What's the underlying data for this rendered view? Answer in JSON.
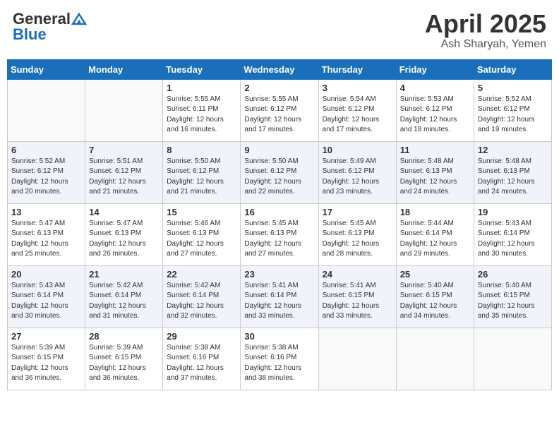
{
  "header": {
    "logo_general": "General",
    "logo_blue": "Blue",
    "title": "April 2025",
    "subtitle": "Ash Sharyah, Yemen"
  },
  "weekdays": [
    "Sunday",
    "Monday",
    "Tuesday",
    "Wednesday",
    "Thursday",
    "Friday",
    "Saturday"
  ],
  "weeks": [
    [
      {
        "day": "",
        "sunrise": "",
        "sunset": "",
        "daylight": ""
      },
      {
        "day": "",
        "sunrise": "",
        "sunset": "",
        "daylight": ""
      },
      {
        "day": "1",
        "sunrise": "Sunrise: 5:55 AM",
        "sunset": "Sunset: 6:11 PM",
        "daylight": "Daylight: 12 hours and 16 minutes."
      },
      {
        "day": "2",
        "sunrise": "Sunrise: 5:55 AM",
        "sunset": "Sunset: 6:12 PM",
        "daylight": "Daylight: 12 hours and 17 minutes."
      },
      {
        "day": "3",
        "sunrise": "Sunrise: 5:54 AM",
        "sunset": "Sunset: 6:12 PM",
        "daylight": "Daylight: 12 hours and 17 minutes."
      },
      {
        "day": "4",
        "sunrise": "Sunrise: 5:53 AM",
        "sunset": "Sunset: 6:12 PM",
        "daylight": "Daylight: 12 hours and 18 minutes."
      },
      {
        "day": "5",
        "sunrise": "Sunrise: 5:52 AM",
        "sunset": "Sunset: 6:12 PM",
        "daylight": "Daylight: 12 hours and 19 minutes."
      }
    ],
    [
      {
        "day": "6",
        "sunrise": "Sunrise: 5:52 AM",
        "sunset": "Sunset: 6:12 PM",
        "daylight": "Daylight: 12 hours and 20 minutes."
      },
      {
        "day": "7",
        "sunrise": "Sunrise: 5:51 AM",
        "sunset": "Sunset: 6:12 PM",
        "daylight": "Daylight: 12 hours and 21 minutes."
      },
      {
        "day": "8",
        "sunrise": "Sunrise: 5:50 AM",
        "sunset": "Sunset: 6:12 PM",
        "daylight": "Daylight: 12 hours and 21 minutes."
      },
      {
        "day": "9",
        "sunrise": "Sunrise: 5:50 AM",
        "sunset": "Sunset: 6:12 PM",
        "daylight": "Daylight: 12 hours and 22 minutes."
      },
      {
        "day": "10",
        "sunrise": "Sunrise: 5:49 AM",
        "sunset": "Sunset: 6:12 PM",
        "daylight": "Daylight: 12 hours and 23 minutes."
      },
      {
        "day": "11",
        "sunrise": "Sunrise: 5:48 AM",
        "sunset": "Sunset: 6:13 PM",
        "daylight": "Daylight: 12 hours and 24 minutes."
      },
      {
        "day": "12",
        "sunrise": "Sunrise: 5:48 AM",
        "sunset": "Sunset: 6:13 PM",
        "daylight": "Daylight: 12 hours and 24 minutes."
      }
    ],
    [
      {
        "day": "13",
        "sunrise": "Sunrise: 5:47 AM",
        "sunset": "Sunset: 6:13 PM",
        "daylight": "Daylight: 12 hours and 25 minutes."
      },
      {
        "day": "14",
        "sunrise": "Sunrise: 5:47 AM",
        "sunset": "Sunset: 6:13 PM",
        "daylight": "Daylight: 12 hours and 26 minutes."
      },
      {
        "day": "15",
        "sunrise": "Sunrise: 5:46 AM",
        "sunset": "Sunset: 6:13 PM",
        "daylight": "Daylight: 12 hours and 27 minutes."
      },
      {
        "day": "16",
        "sunrise": "Sunrise: 5:45 AM",
        "sunset": "Sunset: 6:13 PM",
        "daylight": "Daylight: 12 hours and 27 minutes."
      },
      {
        "day": "17",
        "sunrise": "Sunrise: 5:45 AM",
        "sunset": "Sunset: 6:13 PM",
        "daylight": "Daylight: 12 hours and 28 minutes."
      },
      {
        "day": "18",
        "sunrise": "Sunrise: 5:44 AM",
        "sunset": "Sunset: 6:14 PM",
        "daylight": "Daylight: 12 hours and 29 minutes."
      },
      {
        "day": "19",
        "sunrise": "Sunrise: 5:43 AM",
        "sunset": "Sunset: 6:14 PM",
        "daylight": "Daylight: 12 hours and 30 minutes."
      }
    ],
    [
      {
        "day": "20",
        "sunrise": "Sunrise: 5:43 AM",
        "sunset": "Sunset: 6:14 PM",
        "daylight": "Daylight: 12 hours and 30 minutes."
      },
      {
        "day": "21",
        "sunrise": "Sunrise: 5:42 AM",
        "sunset": "Sunset: 6:14 PM",
        "daylight": "Daylight: 12 hours and 31 minutes."
      },
      {
        "day": "22",
        "sunrise": "Sunrise: 5:42 AM",
        "sunset": "Sunset: 6:14 PM",
        "daylight": "Daylight: 12 hours and 32 minutes."
      },
      {
        "day": "23",
        "sunrise": "Sunrise: 5:41 AM",
        "sunset": "Sunset: 6:14 PM",
        "daylight": "Daylight: 12 hours and 33 minutes."
      },
      {
        "day": "24",
        "sunrise": "Sunrise: 5:41 AM",
        "sunset": "Sunset: 6:15 PM",
        "daylight": "Daylight: 12 hours and 33 minutes."
      },
      {
        "day": "25",
        "sunrise": "Sunrise: 5:40 AM",
        "sunset": "Sunset: 6:15 PM",
        "daylight": "Daylight: 12 hours and 34 minutes."
      },
      {
        "day": "26",
        "sunrise": "Sunrise: 5:40 AM",
        "sunset": "Sunset: 6:15 PM",
        "daylight": "Daylight: 12 hours and 35 minutes."
      }
    ],
    [
      {
        "day": "27",
        "sunrise": "Sunrise: 5:39 AM",
        "sunset": "Sunset: 6:15 PM",
        "daylight": "Daylight: 12 hours and 36 minutes."
      },
      {
        "day": "28",
        "sunrise": "Sunrise: 5:39 AM",
        "sunset": "Sunset: 6:15 PM",
        "daylight": "Daylight: 12 hours and 36 minutes."
      },
      {
        "day": "29",
        "sunrise": "Sunrise: 5:38 AM",
        "sunset": "Sunset: 6:16 PM",
        "daylight": "Daylight: 12 hours and 37 minutes."
      },
      {
        "day": "30",
        "sunrise": "Sunrise: 5:38 AM",
        "sunset": "Sunset: 6:16 PM",
        "daylight": "Daylight: 12 hours and 38 minutes."
      },
      {
        "day": "",
        "sunrise": "",
        "sunset": "",
        "daylight": ""
      },
      {
        "day": "",
        "sunrise": "",
        "sunset": "",
        "daylight": ""
      },
      {
        "day": "",
        "sunrise": "",
        "sunset": "",
        "daylight": ""
      }
    ]
  ]
}
